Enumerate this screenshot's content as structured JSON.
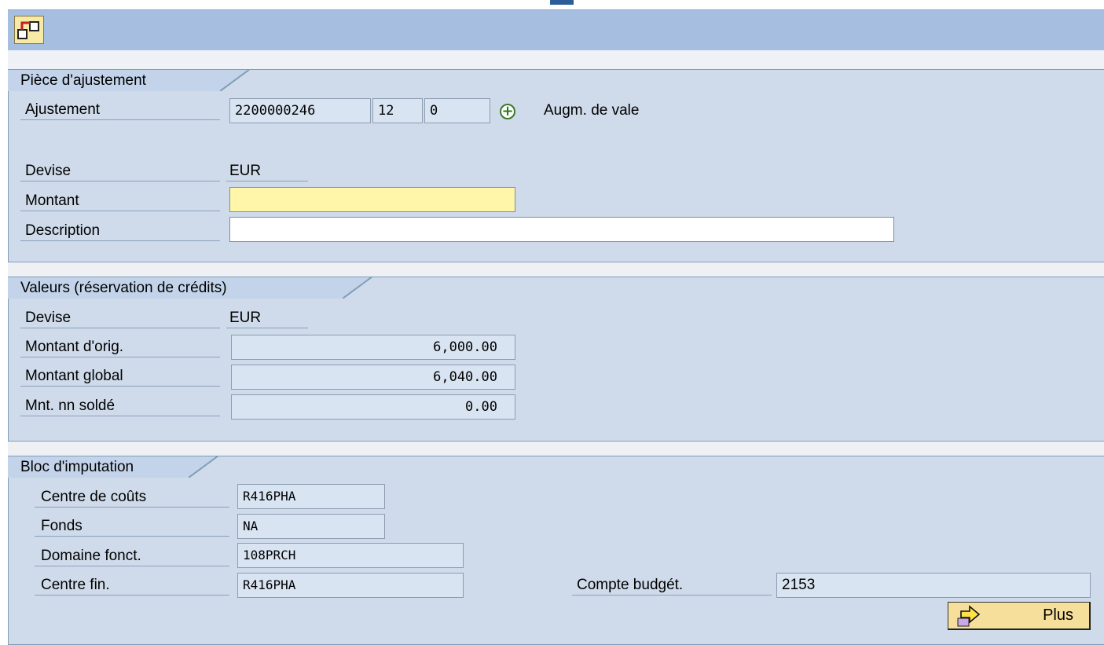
{
  "toolbar": {
    "icon": "hierarchy-icon"
  },
  "piece": {
    "title": "Pièce d'ajustement",
    "ajustement": {
      "label": "Ajustement",
      "doc": "2200000246",
      "pos": "12",
      "num": "0",
      "type_text": "Augm. de vale"
    },
    "devise": {
      "label": "Devise",
      "value": "EUR"
    },
    "montant": {
      "label": "Montant",
      "value": ""
    },
    "description": {
      "label": "Description",
      "value": ""
    }
  },
  "valeurs": {
    "title": "Valeurs (réservation de crédits)",
    "devise": {
      "label": "Devise",
      "value": "EUR"
    },
    "montant_orig": {
      "label": "Montant d'orig.",
      "value": "6,000.00"
    },
    "montant_global": {
      "label": "Montant global",
      "value": "6,040.00"
    },
    "mnt_nn_solde": {
      "label": "Mnt. nn soldé",
      "value": "0.00"
    }
  },
  "bloc": {
    "title": "Bloc d'imputation",
    "centre_couts": {
      "label": "Centre de coûts",
      "value": "R416PHA"
    },
    "fonds": {
      "label": "Fonds",
      "value": "NA"
    },
    "domaine": {
      "label": "Domaine fonct.",
      "value": "108PRCH"
    },
    "centre_fin": {
      "label": "Centre fin.",
      "value": "R416PHA"
    },
    "compte": {
      "label": "Compte budgét.",
      "value": "2153"
    },
    "plus_button": "Plus"
  },
  "colors": {
    "toolbar": "#a6bedf",
    "group_bg": "#cfdbea",
    "edit_field": "#fff6aa",
    "button": "#f6df9b"
  }
}
